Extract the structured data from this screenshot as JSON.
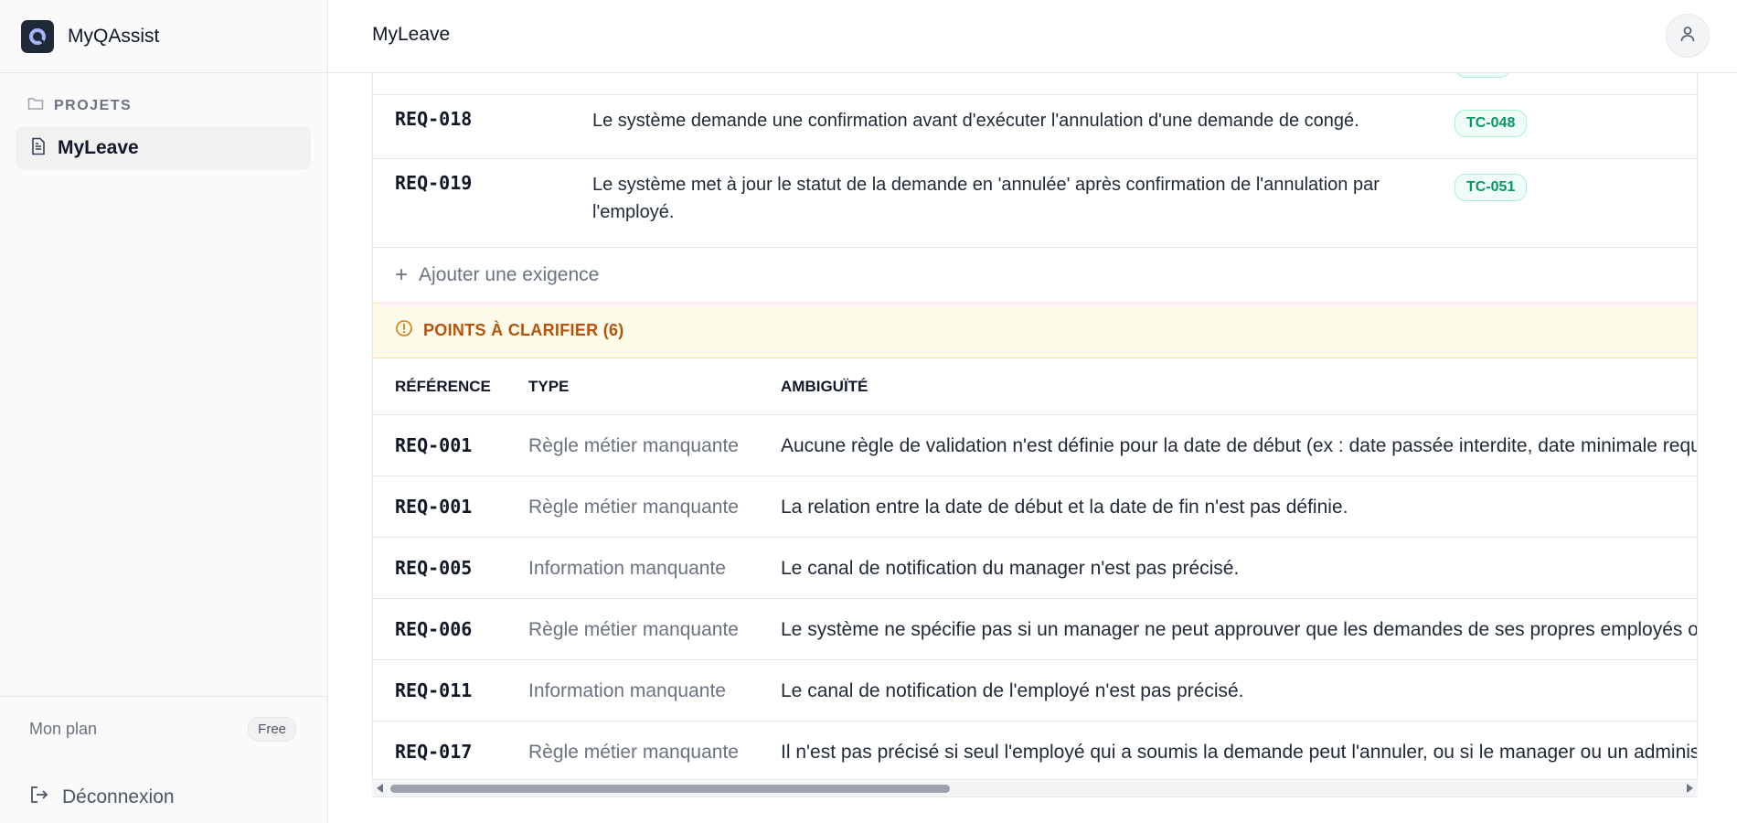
{
  "app": {
    "name": "MyQAssist"
  },
  "sidebar": {
    "section_label": "PROJETS",
    "items": [
      {
        "label": "MyLeave"
      }
    ],
    "plan_label": "Mon plan",
    "plan_badge": "Free",
    "logout_label": "Déconnexion"
  },
  "header": {
    "title": "MyLeave"
  },
  "requirements": [
    {
      "id": "REQ-018",
      "description": "Le système demande une confirmation avant d'exécuter l'annulation d'une demande de congé.",
      "test_case": "TC-048"
    },
    {
      "id": "REQ-019",
      "description": "Le système met à jour le statut de la demande en 'annulée' après confirmation de l'annulation par l'employé.",
      "test_case": "TC-051"
    }
  ],
  "add_requirement_label": "Ajouter une exigence",
  "clarify": {
    "title": "POINTS À CLARIFIER (6)",
    "columns": [
      "RÉFÉRENCE",
      "TYPE",
      "AMBIGUÏTÉ"
    ],
    "rows": [
      {
        "ref": "REQ-001",
        "type": "Règle métier manquante",
        "text": "Aucune règle de validation n'est définie pour la date de début (ex : date passée interdite, date minimale requ"
      },
      {
        "ref": "REQ-001",
        "type": "Règle métier manquante",
        "text": "La relation entre la date de début et la date de fin n'est pas définie."
      },
      {
        "ref": "REQ-005",
        "type": "Information manquante",
        "text": "Le canal de notification du manager n'est pas précisé."
      },
      {
        "ref": "REQ-006",
        "type": "Règle métier manquante",
        "text": "Le système ne spécifie pas si un manager ne peut approuver que les demandes de ses propres employés ou"
      },
      {
        "ref": "REQ-011",
        "type": "Information manquante",
        "text": "Le canal de notification de l'employé n'est pas précisé."
      },
      {
        "ref": "REQ-017",
        "type": "Règle métier manquante",
        "text": "Il n'est pas précisé si seul l'employé qui a soumis la demande peut l'annuler, ou si le manager ou un administ"
      }
    ]
  }
}
